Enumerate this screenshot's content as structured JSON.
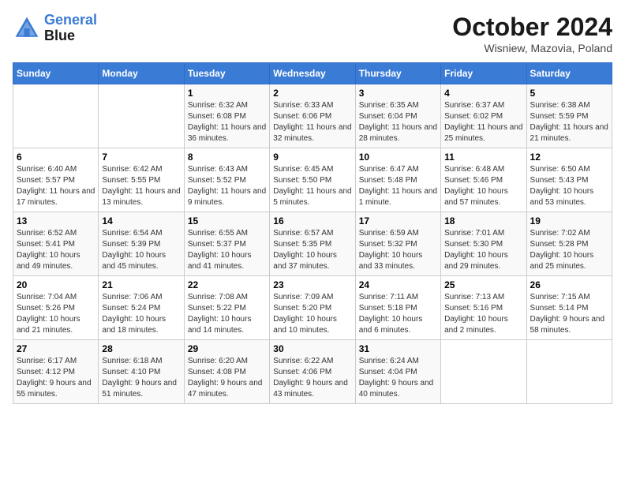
{
  "logo": {
    "line1": "General",
    "line2": "Blue"
  },
  "title": "October 2024",
  "subtitle": "Wisniew, Mazovia, Poland",
  "days_of_week": [
    "Sunday",
    "Monday",
    "Tuesday",
    "Wednesday",
    "Thursday",
    "Friday",
    "Saturday"
  ],
  "weeks": [
    [
      {
        "day": "",
        "sunrise": "",
        "sunset": "",
        "daylight": ""
      },
      {
        "day": "",
        "sunrise": "",
        "sunset": "",
        "daylight": ""
      },
      {
        "day": "1",
        "sunrise": "Sunrise: 6:32 AM",
        "sunset": "Sunset: 6:08 PM",
        "daylight": "Daylight: 11 hours and 36 minutes."
      },
      {
        "day": "2",
        "sunrise": "Sunrise: 6:33 AM",
        "sunset": "Sunset: 6:06 PM",
        "daylight": "Daylight: 11 hours and 32 minutes."
      },
      {
        "day": "3",
        "sunrise": "Sunrise: 6:35 AM",
        "sunset": "Sunset: 6:04 PM",
        "daylight": "Daylight: 11 hours and 28 minutes."
      },
      {
        "day": "4",
        "sunrise": "Sunrise: 6:37 AM",
        "sunset": "Sunset: 6:02 PM",
        "daylight": "Daylight: 11 hours and 25 minutes."
      },
      {
        "day": "5",
        "sunrise": "Sunrise: 6:38 AM",
        "sunset": "Sunset: 5:59 PM",
        "daylight": "Daylight: 11 hours and 21 minutes."
      }
    ],
    [
      {
        "day": "6",
        "sunrise": "Sunrise: 6:40 AM",
        "sunset": "Sunset: 5:57 PM",
        "daylight": "Daylight: 11 hours and 17 minutes."
      },
      {
        "day": "7",
        "sunrise": "Sunrise: 6:42 AM",
        "sunset": "Sunset: 5:55 PM",
        "daylight": "Daylight: 11 hours and 13 minutes."
      },
      {
        "day": "8",
        "sunrise": "Sunrise: 6:43 AM",
        "sunset": "Sunset: 5:52 PM",
        "daylight": "Daylight: 11 hours and 9 minutes."
      },
      {
        "day": "9",
        "sunrise": "Sunrise: 6:45 AM",
        "sunset": "Sunset: 5:50 PM",
        "daylight": "Daylight: 11 hours and 5 minutes."
      },
      {
        "day": "10",
        "sunrise": "Sunrise: 6:47 AM",
        "sunset": "Sunset: 5:48 PM",
        "daylight": "Daylight: 11 hours and 1 minute."
      },
      {
        "day": "11",
        "sunrise": "Sunrise: 6:48 AM",
        "sunset": "Sunset: 5:46 PM",
        "daylight": "Daylight: 10 hours and 57 minutes."
      },
      {
        "day": "12",
        "sunrise": "Sunrise: 6:50 AM",
        "sunset": "Sunset: 5:43 PM",
        "daylight": "Daylight: 10 hours and 53 minutes."
      }
    ],
    [
      {
        "day": "13",
        "sunrise": "Sunrise: 6:52 AM",
        "sunset": "Sunset: 5:41 PM",
        "daylight": "Daylight: 10 hours and 49 minutes."
      },
      {
        "day": "14",
        "sunrise": "Sunrise: 6:54 AM",
        "sunset": "Sunset: 5:39 PM",
        "daylight": "Daylight: 10 hours and 45 minutes."
      },
      {
        "day": "15",
        "sunrise": "Sunrise: 6:55 AM",
        "sunset": "Sunset: 5:37 PM",
        "daylight": "Daylight: 10 hours and 41 minutes."
      },
      {
        "day": "16",
        "sunrise": "Sunrise: 6:57 AM",
        "sunset": "Sunset: 5:35 PM",
        "daylight": "Daylight: 10 hours and 37 minutes."
      },
      {
        "day": "17",
        "sunrise": "Sunrise: 6:59 AM",
        "sunset": "Sunset: 5:32 PM",
        "daylight": "Daylight: 10 hours and 33 minutes."
      },
      {
        "day": "18",
        "sunrise": "Sunrise: 7:01 AM",
        "sunset": "Sunset: 5:30 PM",
        "daylight": "Daylight: 10 hours and 29 minutes."
      },
      {
        "day": "19",
        "sunrise": "Sunrise: 7:02 AM",
        "sunset": "Sunset: 5:28 PM",
        "daylight": "Daylight: 10 hours and 25 minutes."
      }
    ],
    [
      {
        "day": "20",
        "sunrise": "Sunrise: 7:04 AM",
        "sunset": "Sunset: 5:26 PM",
        "daylight": "Daylight: 10 hours and 21 minutes."
      },
      {
        "day": "21",
        "sunrise": "Sunrise: 7:06 AM",
        "sunset": "Sunset: 5:24 PM",
        "daylight": "Daylight: 10 hours and 18 minutes."
      },
      {
        "day": "22",
        "sunrise": "Sunrise: 7:08 AM",
        "sunset": "Sunset: 5:22 PM",
        "daylight": "Daylight: 10 hours and 14 minutes."
      },
      {
        "day": "23",
        "sunrise": "Sunrise: 7:09 AM",
        "sunset": "Sunset: 5:20 PM",
        "daylight": "Daylight: 10 hours and 10 minutes."
      },
      {
        "day": "24",
        "sunrise": "Sunrise: 7:11 AM",
        "sunset": "Sunset: 5:18 PM",
        "daylight": "Daylight: 10 hours and 6 minutes."
      },
      {
        "day": "25",
        "sunrise": "Sunrise: 7:13 AM",
        "sunset": "Sunset: 5:16 PM",
        "daylight": "Daylight: 10 hours and 2 minutes."
      },
      {
        "day": "26",
        "sunrise": "Sunrise: 7:15 AM",
        "sunset": "Sunset: 5:14 PM",
        "daylight": "Daylight: 9 hours and 58 minutes."
      }
    ],
    [
      {
        "day": "27",
        "sunrise": "Sunrise: 6:17 AM",
        "sunset": "Sunset: 4:12 PM",
        "daylight": "Daylight: 9 hours and 55 minutes."
      },
      {
        "day": "28",
        "sunrise": "Sunrise: 6:18 AM",
        "sunset": "Sunset: 4:10 PM",
        "daylight": "Daylight: 9 hours and 51 minutes."
      },
      {
        "day": "29",
        "sunrise": "Sunrise: 6:20 AM",
        "sunset": "Sunset: 4:08 PM",
        "daylight": "Daylight: 9 hours and 47 minutes."
      },
      {
        "day": "30",
        "sunrise": "Sunrise: 6:22 AM",
        "sunset": "Sunset: 4:06 PM",
        "daylight": "Daylight: 9 hours and 43 minutes."
      },
      {
        "day": "31",
        "sunrise": "Sunrise: 6:24 AM",
        "sunset": "Sunset: 4:04 PM",
        "daylight": "Daylight: 9 hours and 40 minutes."
      },
      {
        "day": "",
        "sunrise": "",
        "sunset": "",
        "daylight": ""
      },
      {
        "day": "",
        "sunrise": "",
        "sunset": "",
        "daylight": ""
      }
    ]
  ]
}
